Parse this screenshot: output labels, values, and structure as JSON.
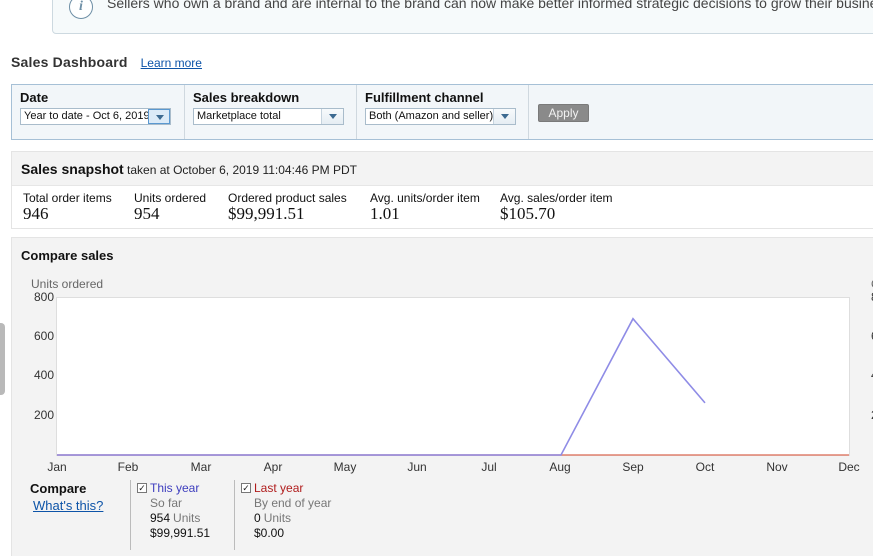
{
  "banner": {
    "message": "Sellers who own a brand and are internal to the brand can now make better informed strategic decisions to grow their business"
  },
  "header": {
    "title": "Sales Dashboard",
    "learn_more": "Learn more"
  },
  "filters": {
    "date": {
      "label": "Date",
      "value": "Year to date - Oct 6, 2019"
    },
    "breakdown": {
      "label": "Sales breakdown",
      "value": "Marketplace total"
    },
    "fulfillment": {
      "label": "Fulfillment channel",
      "value": "Both (Amazon and seller)"
    },
    "apply_label": "Apply"
  },
  "snapshot": {
    "title": "Sales snapshot",
    "timestamp": "taken at October 6, 2019 11:04:46 PM PDT",
    "metrics": [
      {
        "label": "Total order items",
        "value": "946"
      },
      {
        "label": "Units ordered",
        "value": "954"
      },
      {
        "label": "Ordered product sales",
        "value": "$99,991.51"
      },
      {
        "label": "Avg. units/order item",
        "value": "1.01"
      },
      {
        "label": "Avg. sales/order item",
        "value": "$105.70"
      }
    ]
  },
  "compare": {
    "title": "Compare sales",
    "right_axis_clip": "O",
    "right_ticks_clip": [
      "8",
      "6",
      "4",
      "2"
    ],
    "compare_label": "Compare",
    "whats_this": "What's this?",
    "this_year": {
      "label": "This year",
      "period": "So far",
      "units_value": "954",
      "units_label": "Units",
      "sales": "$99,991.51",
      "color": "#3d3dbe"
    },
    "last_year": {
      "label": "Last year",
      "period": "By end of year",
      "units_value": "0",
      "units_label": "Units",
      "sales": "$0.00",
      "color": "#b01c1c"
    }
  },
  "chart_data": {
    "type": "line",
    "ylabel": "Units ordered",
    "ylim": [
      0,
      800
    ],
    "yticks": [
      "800",
      "600",
      "400",
      "200"
    ],
    "categories": [
      "Jan",
      "Feb",
      "Mar",
      "Apr",
      "May",
      "Jun",
      "Jul",
      "Aug",
      "Sep",
      "Oct",
      "Nov",
      "Dec"
    ],
    "series": [
      {
        "name": "This year",
        "color": "#8f8ce6",
        "values": [
          0,
          0,
          0,
          0,
          0,
          0,
          0,
          0,
          690,
          264,
          null,
          null
        ]
      },
      {
        "name": "Last year",
        "color": "#e0806f",
        "values": [
          0,
          0,
          0,
          0,
          0,
          0,
          0,
          0,
          0,
          0,
          0,
          0
        ]
      }
    ],
    "grid": false
  }
}
